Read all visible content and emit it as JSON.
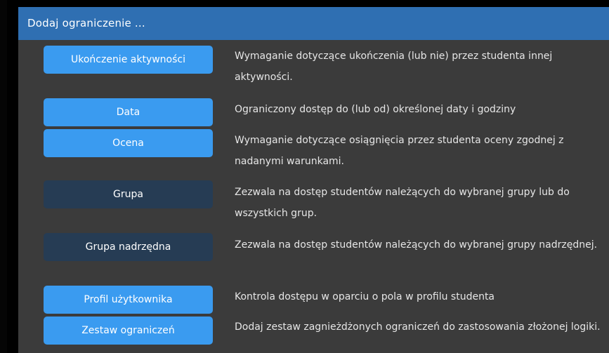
{
  "dialog": {
    "title": "Dodaj ograniczenie ..."
  },
  "options": [
    {
      "label": "Ukończenie aktywności",
      "description": "Wymaganie dotyczące ukończenia (lub nie) przez studenta innej aktywności.",
      "style": "primary"
    },
    {
      "label": "Data",
      "description": "Ograniczony dostęp do (lub od) określonej daty i godziny",
      "style": "primary"
    },
    {
      "label": "Ocena",
      "description": "Wymaganie dotyczące osiągnięcia przez studenta oceny zgodnej z nadanymi warunkami.",
      "style": "primary"
    },
    {
      "label": "Grupa",
      "description": "Zezwala na dostęp studentów należących do wybranej grupy lub do wszystkich grup.",
      "style": "muted"
    },
    {
      "label": "Grupa nadrzędna",
      "description": "Zezwala na dostęp studentów należących do wybranej grupy nadrzędnej.",
      "style": "muted"
    },
    {
      "label": "Profil użytkownika",
      "description": "Kontrola dostępu w oparciu o pola w profilu studenta",
      "style": "primary"
    },
    {
      "label": "Zestaw ograniczeń",
      "description": "Dodaj zestaw zagnieżdżonych ograniczeń do zastosowania złożonej logiki.",
      "style": "primary"
    }
  ],
  "colors": {
    "header": "#2f6fb2",
    "dialog_bg": "#3b3b3b",
    "button_primary": "#3a9bf0",
    "button_muted": "#263c54",
    "text": "#e6e6e6"
  }
}
